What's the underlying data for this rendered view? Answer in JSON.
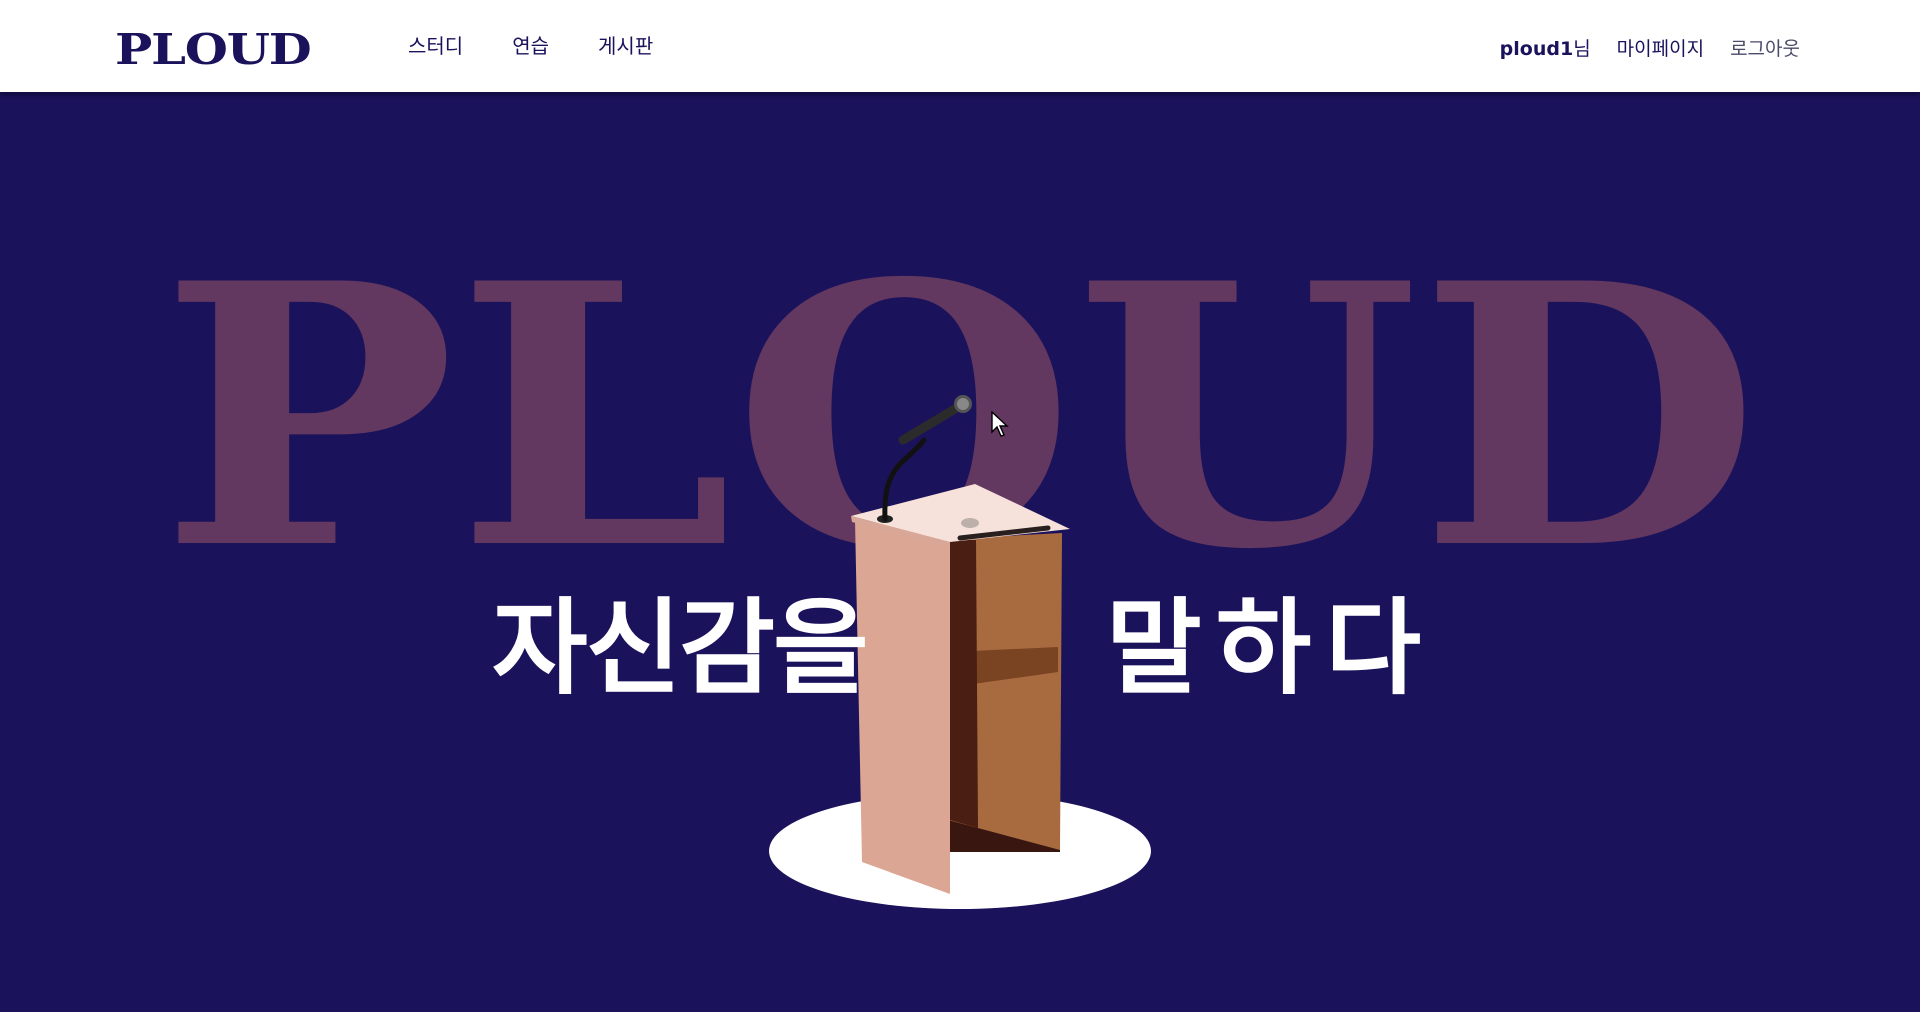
{
  "header": {
    "logo": "PLOUD",
    "nav": [
      {
        "label": "스터디"
      },
      {
        "label": "연습"
      },
      {
        "label": "게시판"
      }
    ],
    "user": {
      "name": "ploud1",
      "suffix": "님",
      "mypage": "마이페이지",
      "logout": "로그아웃"
    }
  },
  "hero": {
    "background_word": "PLOUD",
    "slogan_left": "자신감을",
    "slogan_right": "말하다",
    "illustration": "podium-with-microphone",
    "colors": {
      "background": "#1b125c",
      "background_word": "#623760",
      "slogan": "#ffffff"
    }
  }
}
